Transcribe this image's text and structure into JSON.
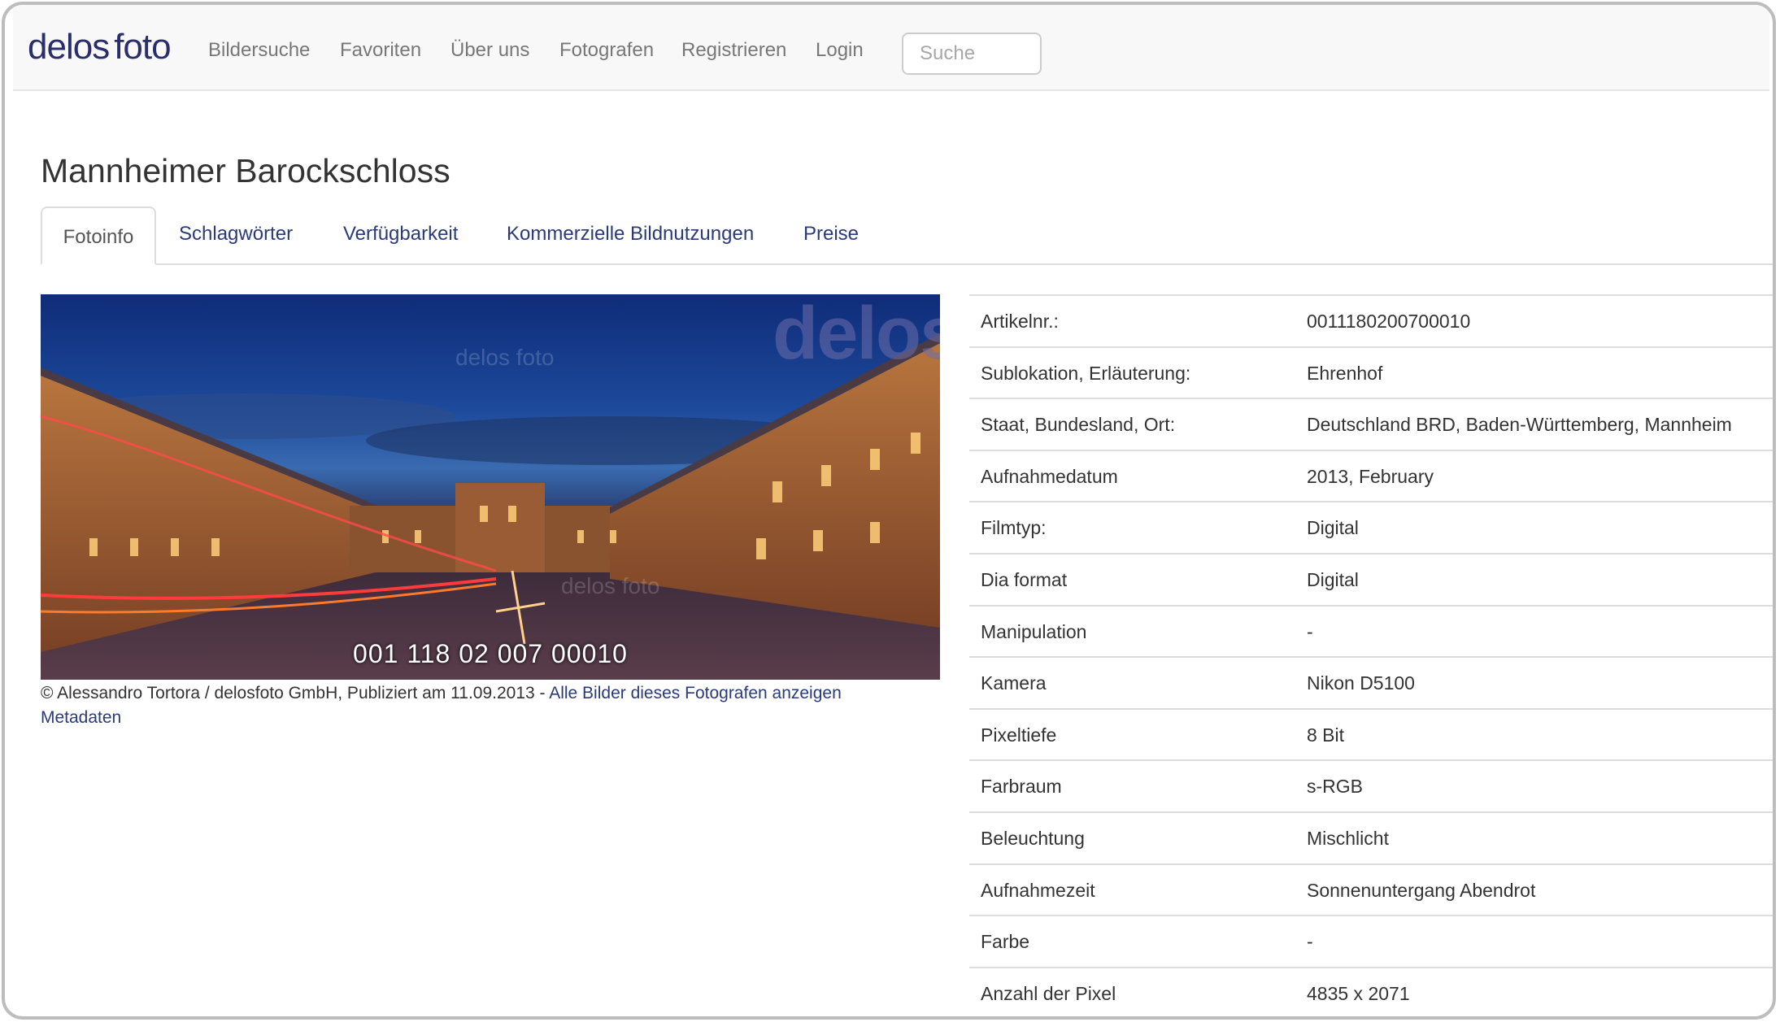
{
  "navbar": {
    "brand_part1": "delos",
    "brand_part2": "foto",
    "items": [
      "Bildersuche",
      "Favoriten",
      "Über uns",
      "Fotografen",
      "Registrieren",
      "Login"
    ],
    "search_placeholder": "Suche"
  },
  "page": {
    "title": "Mannheimer Barockschloss"
  },
  "tabs": [
    "Fotoinfo",
    "Schlagwörter",
    "Verfügbarkeit",
    "Kommerzielle Bildnutzungen",
    "Preise"
  ],
  "photo": {
    "id_overlay": "001 118 02 007 00010",
    "watermark": "delos",
    "watermark_small": "delos foto"
  },
  "caption": {
    "text": "© Alessandro Tortora / delosfoto GmbH, Publiziert am 11.09.2013 - ",
    "link_all": "Alle Bilder dieses Fotografen anzeigen",
    "link_meta": "Metadaten"
  },
  "info": [
    {
      "label": "Artikelnr.:",
      "value": "0011180200700010"
    },
    {
      "label": "Sublokation, Erläuterung:",
      "value": "Ehrenhof"
    },
    {
      "label": "Staat, Bundesland, Ort:",
      "value": "Deutschland BRD, Baden-Württemberg, Mannheim"
    },
    {
      "label": "Aufnahmedatum",
      "value": "2013, February"
    },
    {
      "label": "Filmtyp:",
      "value": "Digital"
    },
    {
      "label": "Dia format",
      "value": "Digital"
    },
    {
      "label": "Manipulation",
      "value": "-"
    },
    {
      "label": "Kamera",
      "value": "Nikon D5100"
    },
    {
      "label": "Pixeltiefe",
      "value": "8 Bit"
    },
    {
      "label": "Farbraum",
      "value": "s-RGB"
    },
    {
      "label": "Beleuchtung",
      "value": "Mischlicht"
    },
    {
      "label": "Aufnahmezeit",
      "value": "Sonnenuntergang Abendrot"
    },
    {
      "label": "Farbe",
      "value": "-"
    },
    {
      "label": "Anzahl der Pixel",
      "value": "4835 x 2071"
    }
  ],
  "colors": {
    "link": "#2a3a7a",
    "brand": "#2a2f6b",
    "nav_text": "#777777",
    "border": "#dddddd"
  }
}
